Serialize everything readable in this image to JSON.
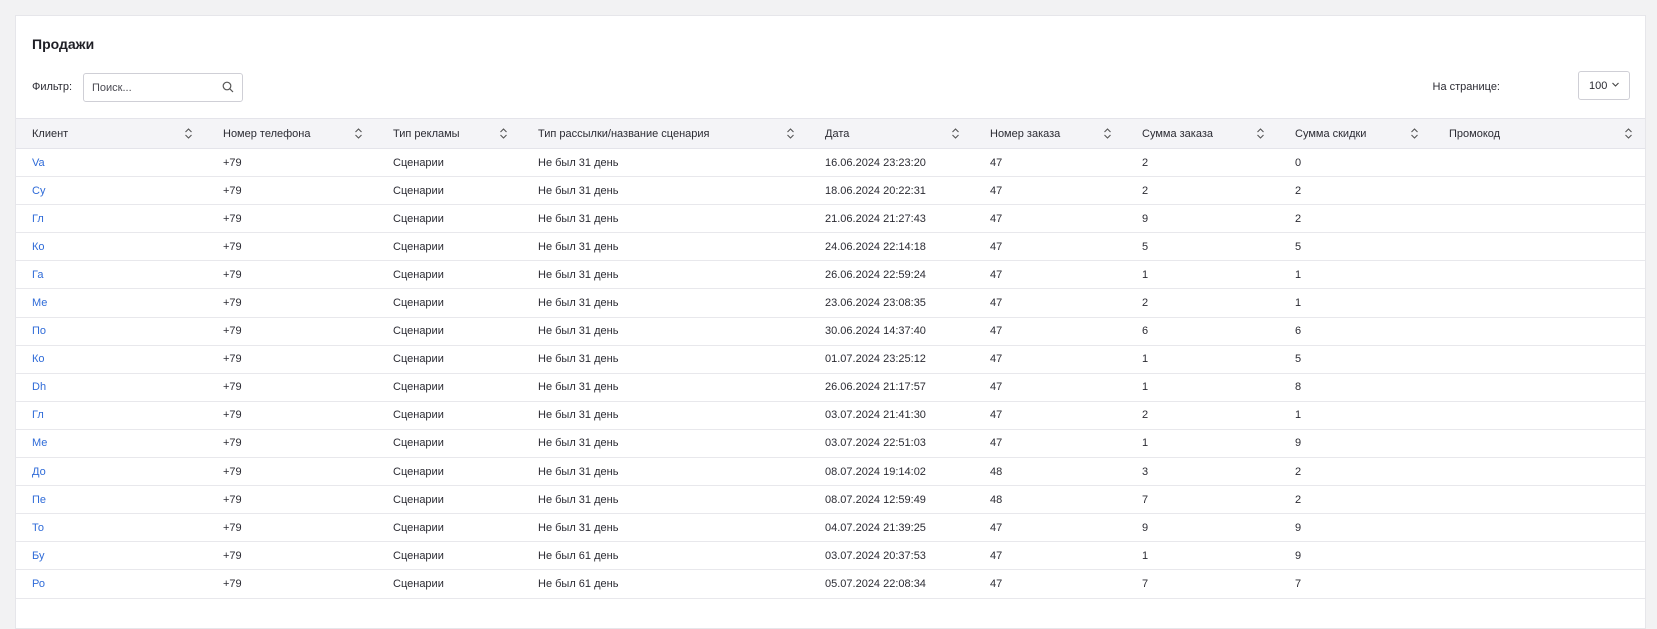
{
  "page": {
    "title": "Продажи",
    "filter_label": "Фильтр:",
    "search_placeholder": "Поиск...",
    "per_page_label": "На странице:",
    "per_page_value": "100"
  },
  "columns": [
    "Клиент",
    "Номер телефона",
    "Тип рекламы",
    "Тип рассылки/название сценария",
    "Дата",
    "Номер заказа",
    "Сумма заказа",
    "Сумма скидки",
    "Промокод"
  ],
  "rows": [
    {
      "client": "Va",
      "phone": "+79",
      "ad_type": "Сценарии",
      "scenario": "Не был 31 день",
      "date": "16.06.2024 23:23:20",
      "order": "47",
      "sum": "2",
      "discount": "0",
      "promo": ""
    },
    {
      "client": "Су",
      "phone": "+79",
      "ad_type": "Сценарии",
      "scenario": "Не был 31 день",
      "date": "18.06.2024 20:22:31",
      "order": "47",
      "sum": "2",
      "discount": "2",
      "promo": ""
    },
    {
      "client": "Гл",
      "phone": "+79",
      "ad_type": "Сценарии",
      "scenario": "Не был 31 день",
      "date": "21.06.2024 21:27:43",
      "order": "47",
      "sum": "9",
      "discount": "2",
      "promo": ""
    },
    {
      "client": "Ко",
      "phone": "+79",
      "ad_type": "Сценарии",
      "scenario": "Не был 31 день",
      "date": "24.06.2024 22:14:18",
      "order": "47",
      "sum": "5",
      "discount": "5",
      "promo": ""
    },
    {
      "client": "Га",
      "phone": "+79",
      "ad_type": "Сценарии",
      "scenario": "Не был 31 день",
      "date": "26.06.2024 22:59:24",
      "order": "47",
      "sum": "1",
      "discount": "1",
      "promo": ""
    },
    {
      "client": "Ме",
      "phone": "+79",
      "ad_type": "Сценарии",
      "scenario": "Не был 31 день",
      "date": "23.06.2024 23:08:35",
      "order": "47",
      "sum": "2",
      "discount": "1",
      "promo": ""
    },
    {
      "client": "По",
      "phone": "+79",
      "ad_type": "Сценарии",
      "scenario": "Не был 31 день",
      "date": "30.06.2024 14:37:40",
      "order": "47",
      "sum": "6",
      "discount": "6",
      "promo": ""
    },
    {
      "client": "Ко",
      "phone": "+79",
      "ad_type": "Сценарии",
      "scenario": "Не был 31 день",
      "date": "01.07.2024 23:25:12",
      "order": "47",
      "sum": "1",
      "discount": "5",
      "promo": ""
    },
    {
      "client": "Dh",
      "phone": "+79",
      "ad_type": "Сценарии",
      "scenario": "Не был 31 день",
      "date": "26.06.2024 21:17:57",
      "order": "47",
      "sum": "1",
      "discount": "8",
      "promo": ""
    },
    {
      "client": "Гл",
      "phone": "+79",
      "ad_type": "Сценарии",
      "scenario": "Не был 31 день",
      "date": "03.07.2024 21:41:30",
      "order": "47",
      "sum": "2",
      "discount": "1",
      "promo": ""
    },
    {
      "client": "Ме",
      "phone": "+79",
      "ad_type": "Сценарии",
      "scenario": "Не был 31 день",
      "date": "03.07.2024 22:51:03",
      "order": "47",
      "sum": "1",
      "discount": "9",
      "promo": ""
    },
    {
      "client": "До",
      "phone": "+79",
      "ad_type": "Сценарии",
      "scenario": "Не был 31 день",
      "date": "08.07.2024 19:14:02",
      "order": "48",
      "sum": "3",
      "discount": "2",
      "promo": ""
    },
    {
      "client": "Пе",
      "phone": "+79",
      "ad_type": "Сценарии",
      "scenario": "Не был 31 день",
      "date": "08.07.2024 12:59:49",
      "order": "48",
      "sum": "7",
      "discount": "2",
      "promo": ""
    },
    {
      "client": "То",
      "phone": "+79",
      "ad_type": "Сценарии",
      "scenario": "Не был 31 день",
      "date": "04.07.2024 21:39:25",
      "order": "47",
      "sum": "9",
      "discount": "9",
      "promo": ""
    },
    {
      "client": "Бу",
      "phone": "+79",
      "ad_type": "Сценарии",
      "scenario": "Не был 61 день",
      "date": "03.07.2024 20:37:53",
      "order": "47",
      "sum": "1",
      "discount": "9",
      "promo": ""
    },
    {
      "client": "Ро",
      "phone": "+79",
      "ad_type": "Сценарии",
      "scenario": "Не был 61 день",
      "date": "05.07.2024 22:08:34",
      "order": "47",
      "sum": "7",
      "discount": "7",
      "promo": ""
    }
  ],
  "colors": {
    "link": "#2f6bd8",
    "header_bg": "#f4f4f7"
  }
}
